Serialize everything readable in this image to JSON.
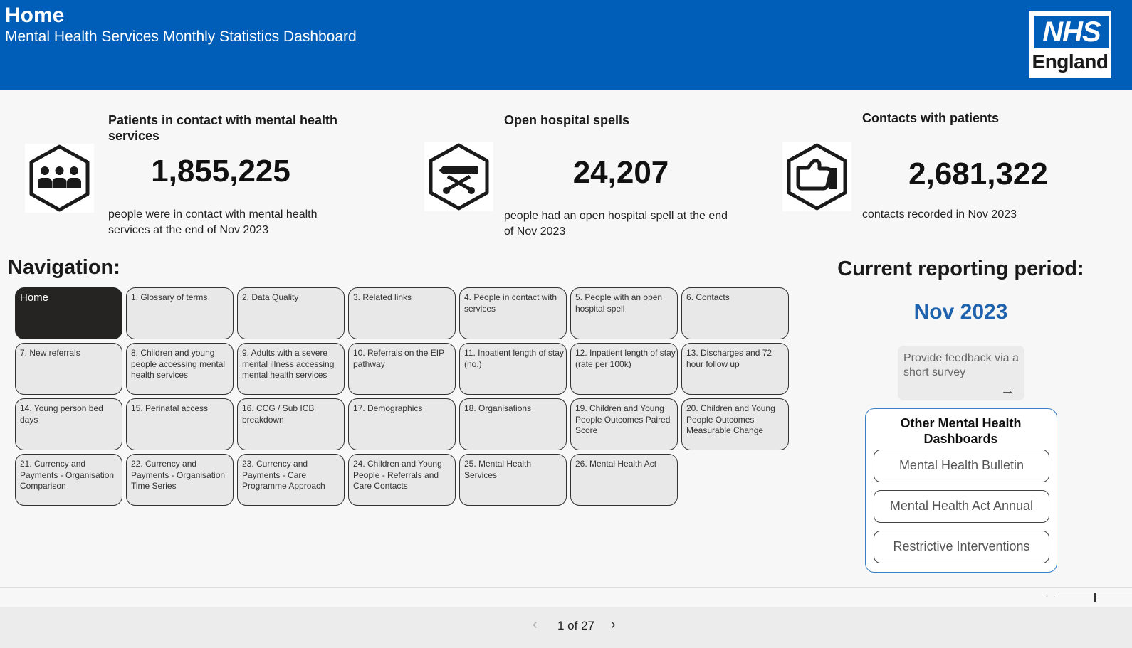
{
  "header": {
    "title": "Home",
    "subtitle": "Mental Health Services Monthly Statistics Dashboard",
    "logo_top": "NHS",
    "logo_bottom": "England",
    "background_color": "#005eb8"
  },
  "kpis": [
    {
      "icon": "people-group-icon",
      "label": "Patients in contact with mental health services",
      "value": "1,855,225",
      "description": "people were in contact with mental health services at the end of Nov 2023"
    },
    {
      "icon": "hospital-bed-icon",
      "label": "Open hospital spells",
      "value": "24,207",
      "description": "people had an open hospital spell at the end of Nov 2023"
    },
    {
      "icon": "handshake-icon",
      "label": "Contacts with patients",
      "value": "2,681,322",
      "description": "contacts recorded in Nov 2023"
    }
  ],
  "navigation": {
    "title": "Navigation:",
    "buttons": [
      "Home",
      "1. Glossary of terms",
      "2. Data Quality",
      "3. Related links",
      "4. People in contact with services",
      "5. People with an open hospital spell",
      "6. Contacts",
      "7. New referrals",
      "8. Children and young people accessing mental health services",
      "9. Adults with a severe mental illness accessing mental health services",
      "10. Referrals on the EIP pathway",
      "11. Inpatient length of stay (no.)",
      "12. Inpatient length of stay (rate per 100k)",
      "13. Discharges and 72 hour follow up",
      "14. Young person bed days",
      "15. Perinatal access",
      "16. CCG / Sub ICB breakdown",
      "17. Demographics",
      "18. Organisations",
      "19. Children and Young People Outcomes Paired Score",
      "20. Children and Young People Outcomes Measurable Change",
      "21. Currency and Payments - Organisation Comparison",
      "22. Currency and Payments - Organisation Time Series",
      "23. Currency and Payments - Care Programme Approach",
      "24. Children and Young People - Referrals and Care Contacts",
      "25. Mental Health Services",
      "26. Mental Health Act"
    ]
  },
  "reporting": {
    "title": "Current reporting period:",
    "period": "Nov 2023",
    "period_color": "#1f62ad"
  },
  "feedback": {
    "text": "Provide feedback via a short survey",
    "arrow": "→"
  },
  "other_dashboards": {
    "title": "Other Mental Health Dashboards",
    "links": [
      "Mental Health Bulletin",
      "Mental Health Act Annual",
      "Restrictive Interventions"
    ]
  },
  "zoom": {
    "minus": "-"
  },
  "pager": {
    "prev": "‹",
    "text": "1 of 27",
    "next": "›"
  }
}
